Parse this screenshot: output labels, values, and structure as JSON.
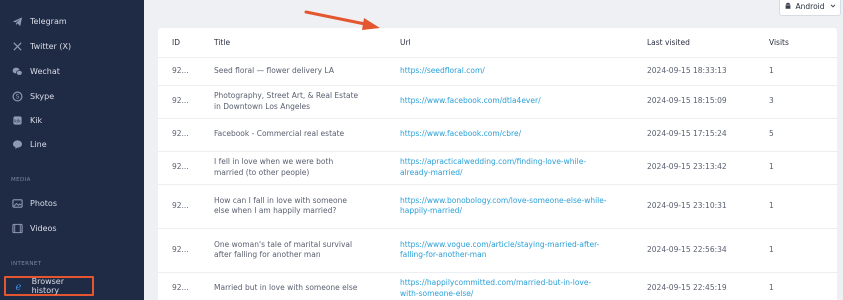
{
  "sidebar": {
    "items_top": [
      {
        "label": "Telegram",
        "icon": "telegram-icon"
      },
      {
        "label": "Twitter (X)",
        "icon": "x-icon"
      },
      {
        "label": "Wechat",
        "icon": "wechat-icon"
      },
      {
        "label": "Skype",
        "icon": "skype-icon"
      },
      {
        "label": "Kik",
        "icon": "kik-icon"
      },
      {
        "label": "Line",
        "icon": "line-icon"
      }
    ],
    "media_label": "MEDIA",
    "media_items": [
      {
        "label": "Photos",
        "icon": "photos-icon"
      },
      {
        "label": "Videos",
        "icon": "videos-icon"
      }
    ],
    "internet_label": "INTERNET",
    "active_item": {
      "label": "Browser history",
      "icon": "browser-icon"
    }
  },
  "header": {
    "device_label": "Android"
  },
  "table": {
    "columns": {
      "id": "ID",
      "title": "Title",
      "url": "Url",
      "last_visited": "Last visited",
      "visits": "Visits"
    },
    "rows": [
      {
        "id": "92...",
        "title": "Seed floral — flower delivery LA",
        "url": "https://seedfloral.com/",
        "last_visited": "2024-09-15 18:33:13",
        "visits": "1"
      },
      {
        "id": "92...",
        "title": "Photography, Street Art, & Real Estate in Downtown Los Angeles",
        "url": "https://www.facebook.com/dtla4ever/",
        "last_visited": "2024-09-15 18:15:09",
        "visits": "3"
      },
      {
        "id": "92...",
        "title": "Facebook - Commercial real estate",
        "url": "https://www.facebook.com/cbre/",
        "last_visited": "2024-09-15 17:15:24",
        "visits": "5"
      },
      {
        "id": "92...",
        "title": "I fell in love when we were both married (to other people)",
        "url": "https://apracticalwedding.com/finding-love-while-already-married/",
        "last_visited": "2024-09-15 23:13:42",
        "visits": "1"
      },
      {
        "id": "92...",
        "title": "How can I fall in love with someone else when I am happily married?",
        "url": "https://www.bonobology.com/love-someone-else-while-happily-married/",
        "last_visited": "2024-09-15 23:10:31",
        "visits": "1"
      },
      {
        "id": "92...",
        "title": "One woman's tale of marital survival after falling for another man",
        "url": "https://www.vogue.com/article/staying-married-after-falling-for-another-man",
        "last_visited": "2024-09-15 22:56:34",
        "visits": "1"
      },
      {
        "id": "92...",
        "title": "Married but in love with someone else",
        "url": "https://happilycommitted.com/married-but-in-love-with-someone-else/",
        "last_visited": "2024-09-15 22:45:19",
        "visits": "1"
      }
    ]
  },
  "colors": {
    "sidebar_bg": "#1f2a44",
    "highlight": "#e3562f",
    "link": "#2aa0d8",
    "arrow": "#e3562f"
  }
}
